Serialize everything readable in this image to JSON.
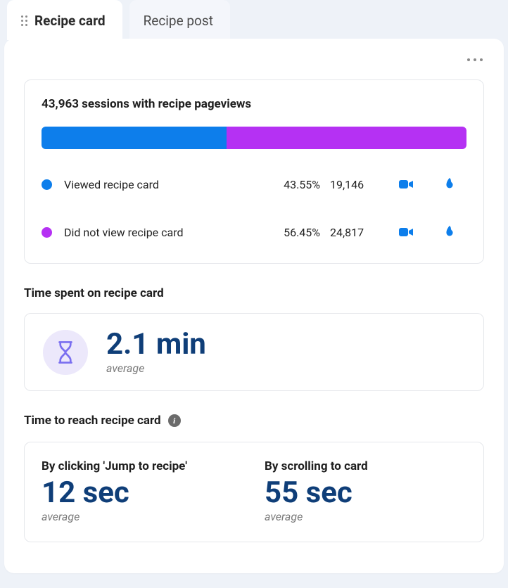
{
  "tabs": {
    "active": "Recipe card",
    "inactive": "Recipe post"
  },
  "sessions": {
    "title": "43,963 sessions with recipe pageviews",
    "rows": [
      {
        "label": "Viewed recipe card",
        "pct": "43.55%",
        "count": "19,146",
        "color": "blue"
      },
      {
        "label": "Did not view recipe card",
        "pct": "56.45%",
        "count": "24,817",
        "color": "purple"
      }
    ]
  },
  "time_spent": {
    "heading": "Time spent on recipe card",
    "value": "2.1 min",
    "avg": "average"
  },
  "time_reach": {
    "heading": "Time to reach recipe card",
    "left": {
      "title": "By clicking 'Jump to recipe'",
      "value": "12 sec",
      "avg": "average"
    },
    "right": {
      "title": "By scrolling to card",
      "value": "55 sec",
      "avg": "average"
    }
  },
  "chart_data": {
    "type": "bar",
    "title": "Sessions with recipe pageviews",
    "total_sessions": 43963,
    "categories": [
      "Viewed recipe card",
      "Did not view recipe card"
    ],
    "values": [
      19146,
      24817
    ],
    "percentages": [
      43.55,
      56.45
    ],
    "colors": [
      "#0d7eeb",
      "#b531f3"
    ]
  }
}
